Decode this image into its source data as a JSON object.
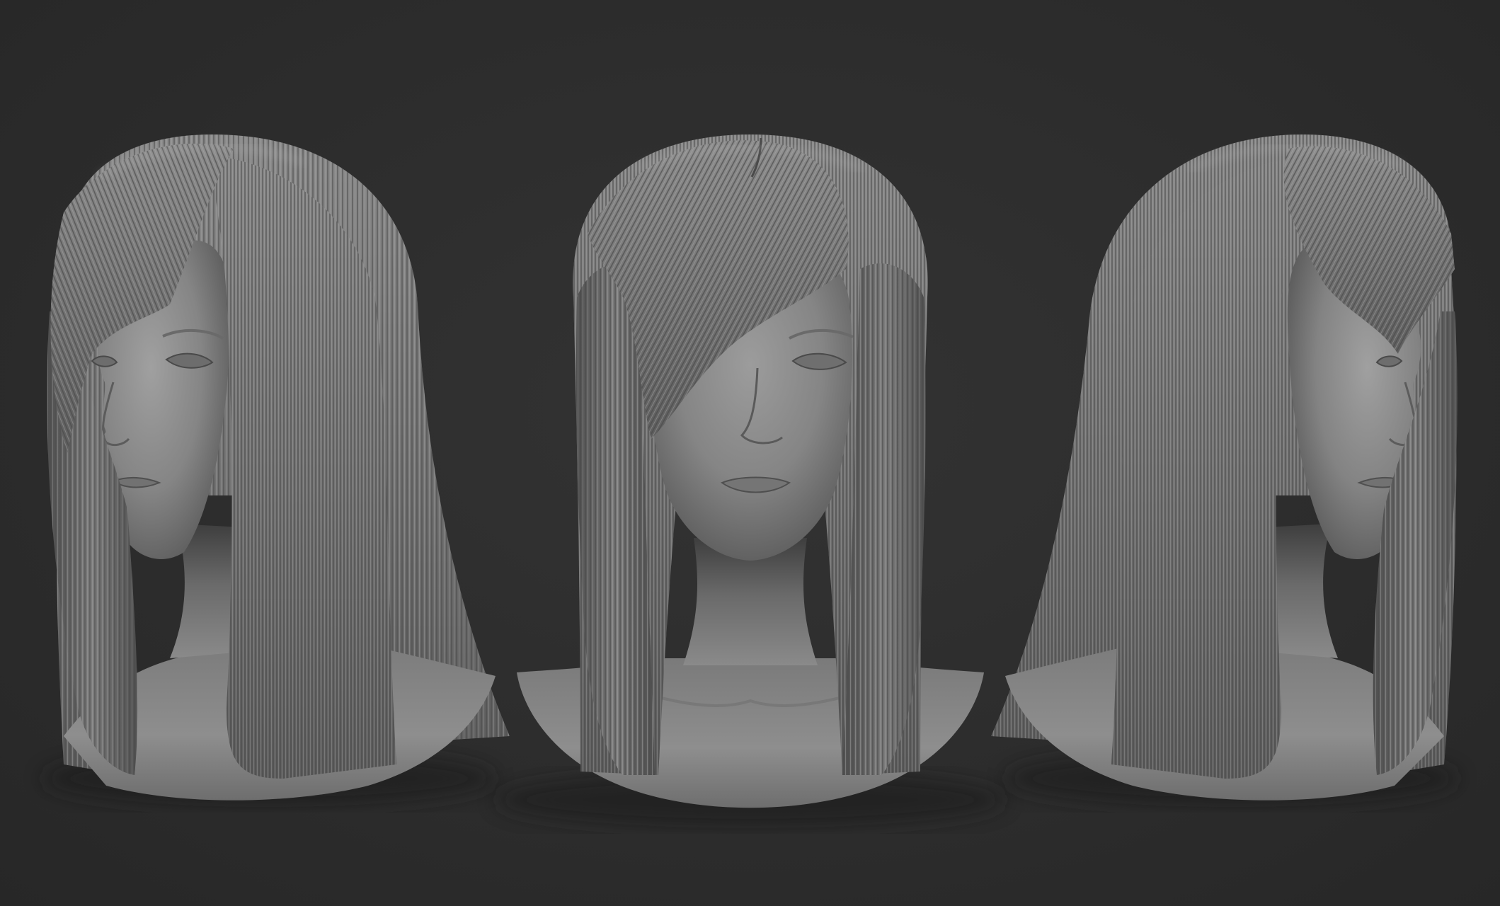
{
  "scene": {
    "background_color": "#2d2d2d",
    "material_color": "#8a8a8a",
    "subject": "sculpted-bust-with-straight-bob-hair",
    "views": [
      {
        "name": "three-quarter-left-view"
      },
      {
        "name": "front-view"
      },
      {
        "name": "three-quarter-right-view"
      }
    ]
  }
}
